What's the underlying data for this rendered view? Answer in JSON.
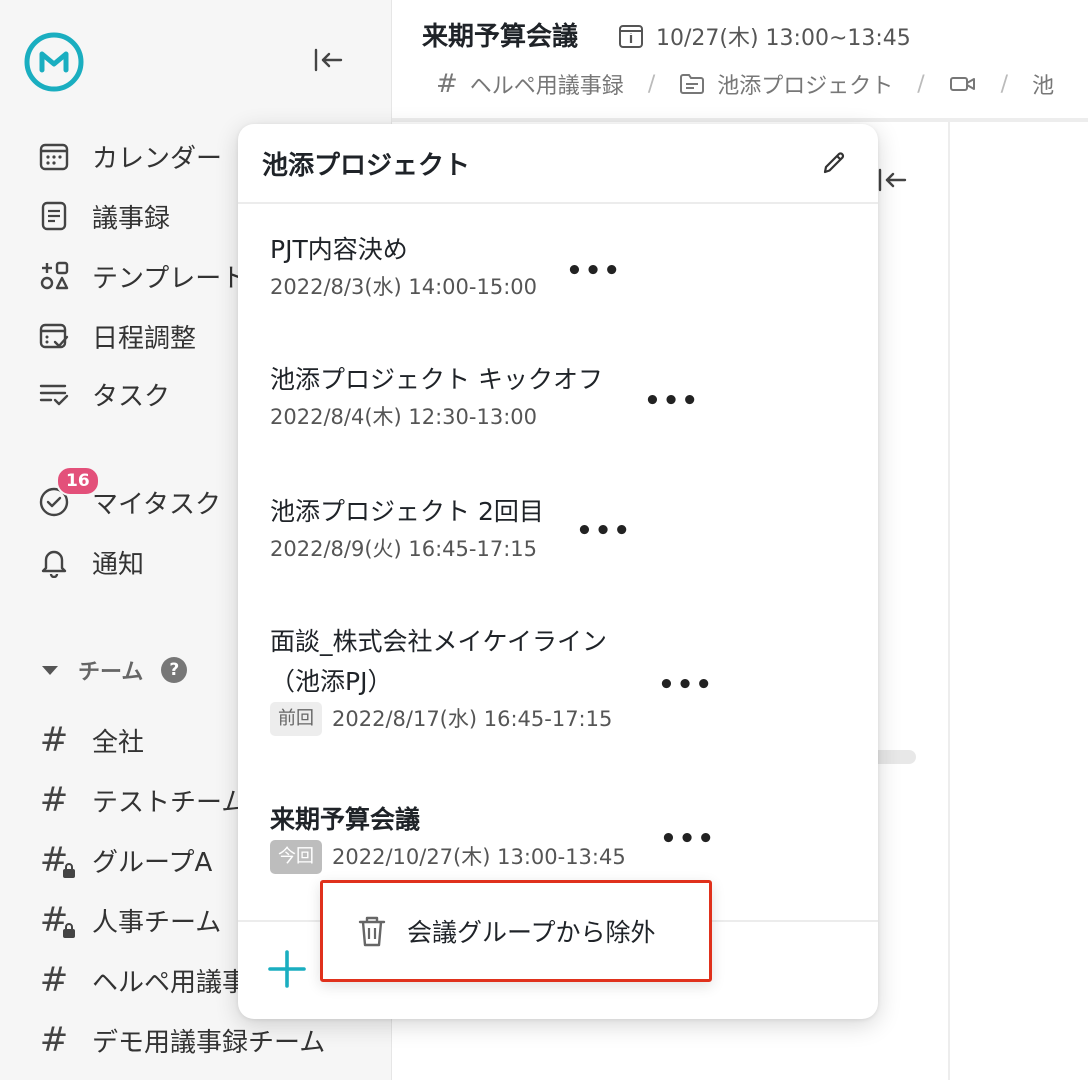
{
  "sidebar": {
    "nav": [
      {
        "label": "カレンダー",
        "icon": "calendar-icon"
      },
      {
        "label": "議事録",
        "icon": "document-icon"
      },
      {
        "label": "テンプレート",
        "icon": "template-icon"
      },
      {
        "label": "日程調整",
        "icon": "schedule-icon"
      },
      {
        "label": "タスク",
        "icon": "task-list-icon"
      }
    ],
    "my_task": {
      "label": "マイタスク",
      "badge": "16",
      "icon": "check-circle-icon"
    },
    "notifications": {
      "label": "通知",
      "icon": "bell-icon"
    },
    "team_header": "チーム",
    "help": "?",
    "teams": [
      {
        "label": "全社",
        "locked": false
      },
      {
        "label": "テストチーム",
        "locked": false
      },
      {
        "label": "グループA",
        "locked": true
      },
      {
        "label": "人事チーム",
        "locked": true
      },
      {
        "label": "ヘルペ用議事録",
        "locked": false
      },
      {
        "label": "デモ用議事録チーム",
        "locked": false
      }
    ]
  },
  "header": {
    "title": "来期予算会議",
    "time": "10/27(木) 13:00~13:45",
    "breadcrumbs": [
      "ヘルペ用議事録",
      "池添プロジェクト"
    ],
    "crumb_tail": "池"
  },
  "popover": {
    "title": "池添プロジェクト",
    "meetings": [
      {
        "title": "PJT内容決め",
        "date": "2022/8/3(水) 14:00-15:00",
        "tag": ""
      },
      {
        "title": "池添プロジェクト キックオフ",
        "date": "2022/8/4(木) 12:30-13:00",
        "tag": ""
      },
      {
        "title": "池添プロジェクト 2回目",
        "date": "2022/8/9(火) 16:45-17:15",
        "tag": ""
      },
      {
        "title": "面談_株式会社メイケイライン",
        "title_line2": "（池添PJ）",
        "date": "2022/8/17(水) 16:45-17:15",
        "tag": "前回"
      },
      {
        "title": "来期予算会議",
        "date": "2022/10/27(木) 13:00-13:45",
        "tag": "今回"
      }
    ],
    "more_label": "•••",
    "add_label": "+"
  },
  "context_menu": {
    "label": "会議グループから除外",
    "icon": "trash-icon",
    "highlight_color": "#e0311c"
  },
  "colors": {
    "accent": "#1aaec0",
    "badge": "#e3507a"
  }
}
